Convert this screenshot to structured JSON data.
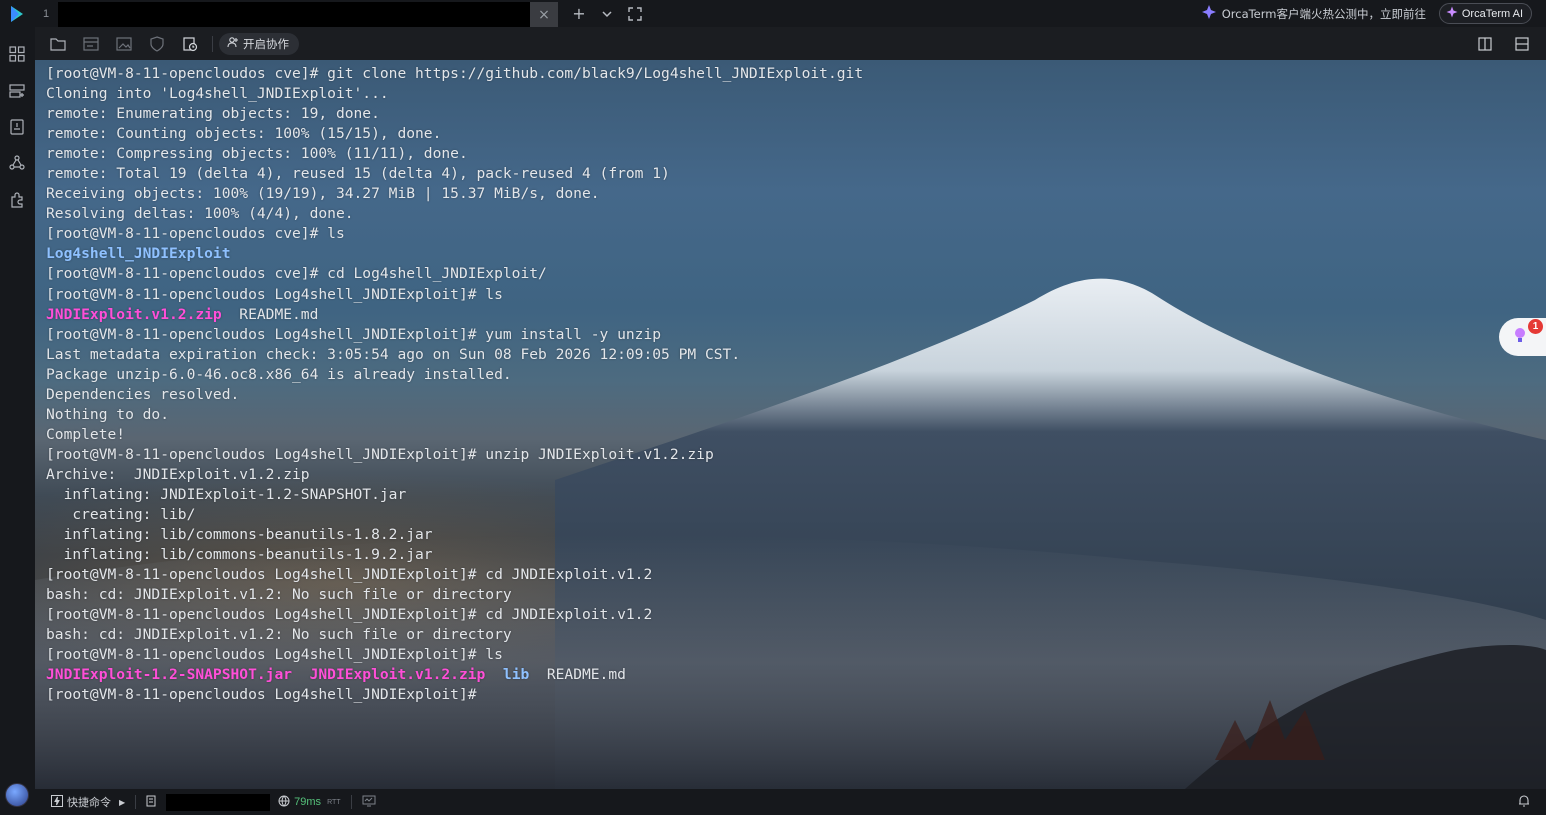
{
  "topbar": {
    "tab_index": "1",
    "close_glyph": "×",
    "new_tab_glyph": "+",
    "dropdown_glyph": "⌄",
    "promo_text": "OrcaTerm客户端火热公测中，立即前往",
    "ai_button_label": "OrcaTerm AI"
  },
  "toolbar": {
    "collab_label": "开启协作"
  },
  "terminal": {
    "lines": [
      [
        {
          "t": "[root@VM-8-11-opencloudos cve]# git clone https://github.com/black9/Log4shell_JNDIExploit.git",
          "c": ""
        }
      ],
      [
        {
          "t": "Cloning into 'Log4shell_JNDIExploit'...",
          "c": ""
        }
      ],
      [
        {
          "t": "remote: Enumerating objects: 19, done.",
          "c": ""
        }
      ],
      [
        {
          "t": "remote: Counting objects: 100% (15/15), done.",
          "c": ""
        }
      ],
      [
        {
          "t": "remote: Compressing objects: 100% (11/11), done.",
          "c": ""
        }
      ],
      [
        {
          "t": "remote: Total 19 (delta 4), reused 15 (delta 4), pack-reused 4 (from 1)",
          "c": ""
        }
      ],
      [
        {
          "t": "Receiving objects: 100% (19/19), 34.27 MiB | 15.37 MiB/s, done.",
          "c": ""
        }
      ],
      [
        {
          "t": "Resolving deltas: 100% (4/4), done.",
          "c": ""
        }
      ],
      [
        {
          "t": "[root@VM-8-11-opencloudos cve]# ls",
          "c": ""
        }
      ],
      [
        {
          "t": "Log4shell_JNDIExploit",
          "c": "dir"
        }
      ],
      [
        {
          "t": "[root@VM-8-11-opencloudos cve]# cd Log4shell_JNDIExploit/",
          "c": ""
        }
      ],
      [
        {
          "t": "[root@VM-8-11-opencloudos Log4shell_JNDIExploit]# ls",
          "c": ""
        }
      ],
      [
        {
          "t": "JNDIExploit.v1.2.zip",
          "c": "zip"
        },
        {
          "t": "  README.md",
          "c": ""
        }
      ],
      [
        {
          "t": "[root@VM-8-11-opencloudos Log4shell_JNDIExploit]# yum install -y unzip",
          "c": ""
        }
      ],
      [
        {
          "t": "Last metadata expiration check: 3:05:54 ago on Sun 08 Feb 2026 12:09:05 PM CST.",
          "c": ""
        }
      ],
      [
        {
          "t": "Package unzip-6.0-46.oc8.x86_64 is already installed.",
          "c": ""
        }
      ],
      [
        {
          "t": "Dependencies resolved.",
          "c": ""
        }
      ],
      [
        {
          "t": "Nothing to do.",
          "c": ""
        }
      ],
      [
        {
          "t": "Complete!",
          "c": ""
        }
      ],
      [
        {
          "t": "[root@VM-8-11-opencloudos Log4shell_JNDIExploit]# unzip JNDIExploit.v1.2.zip",
          "c": ""
        }
      ],
      [
        {
          "t": "Archive:  JNDIExploit.v1.2.zip",
          "c": ""
        }
      ],
      [
        {
          "t": "  inflating: JNDIExploit-1.2-SNAPSHOT.jar",
          "c": ""
        }
      ],
      [
        {
          "t": "   creating: lib/",
          "c": ""
        }
      ],
      [
        {
          "t": "  inflating: lib/commons-beanutils-1.8.2.jar",
          "c": ""
        }
      ],
      [
        {
          "t": "  inflating: lib/commons-beanutils-1.9.2.jar",
          "c": ""
        }
      ],
      [
        {
          "t": "[root@VM-8-11-opencloudos Log4shell_JNDIExploit]# cd JNDIExploit.v1.2",
          "c": ""
        }
      ],
      [
        {
          "t": "bash: cd: JNDIExploit.v1.2: No such file or directory",
          "c": ""
        }
      ],
      [
        {
          "t": "[root@VM-8-11-opencloudos Log4shell_JNDIExploit]# cd JNDIExploit.v1.2",
          "c": ""
        }
      ],
      [
        {
          "t": "bash: cd: JNDIExploit.v1.2: No such file or directory",
          "c": ""
        }
      ],
      [
        {
          "t": "[root@VM-8-11-opencloudos Log4shell_JNDIExploit]# ls",
          "c": ""
        }
      ],
      [
        {
          "t": "JNDIExploit-1.2-SNAPSHOT.jar",
          "c": "zip"
        },
        {
          "t": "  ",
          "c": ""
        },
        {
          "t": "JNDIExploit.v1.2.zip",
          "c": "zip"
        },
        {
          "t": "  ",
          "c": ""
        },
        {
          "t": "lib",
          "c": "dir"
        },
        {
          "t": "  README.md",
          "c": ""
        }
      ],
      [
        {
          "t": "[root@VM-8-11-opencloudos Log4shell_JNDIExploit]#",
          "c": ""
        }
      ]
    ]
  },
  "float_badge": {
    "count": "1",
    "icon": "lightbulb-icon"
  },
  "statusbar": {
    "quick_commands_label": "快捷命令",
    "latency_value": "79ms",
    "latency_unit": "RTT"
  },
  "colors": {
    "directory": "#8fc1ff",
    "archive": "#ff4fd8",
    "latency": "#55c07a"
  }
}
